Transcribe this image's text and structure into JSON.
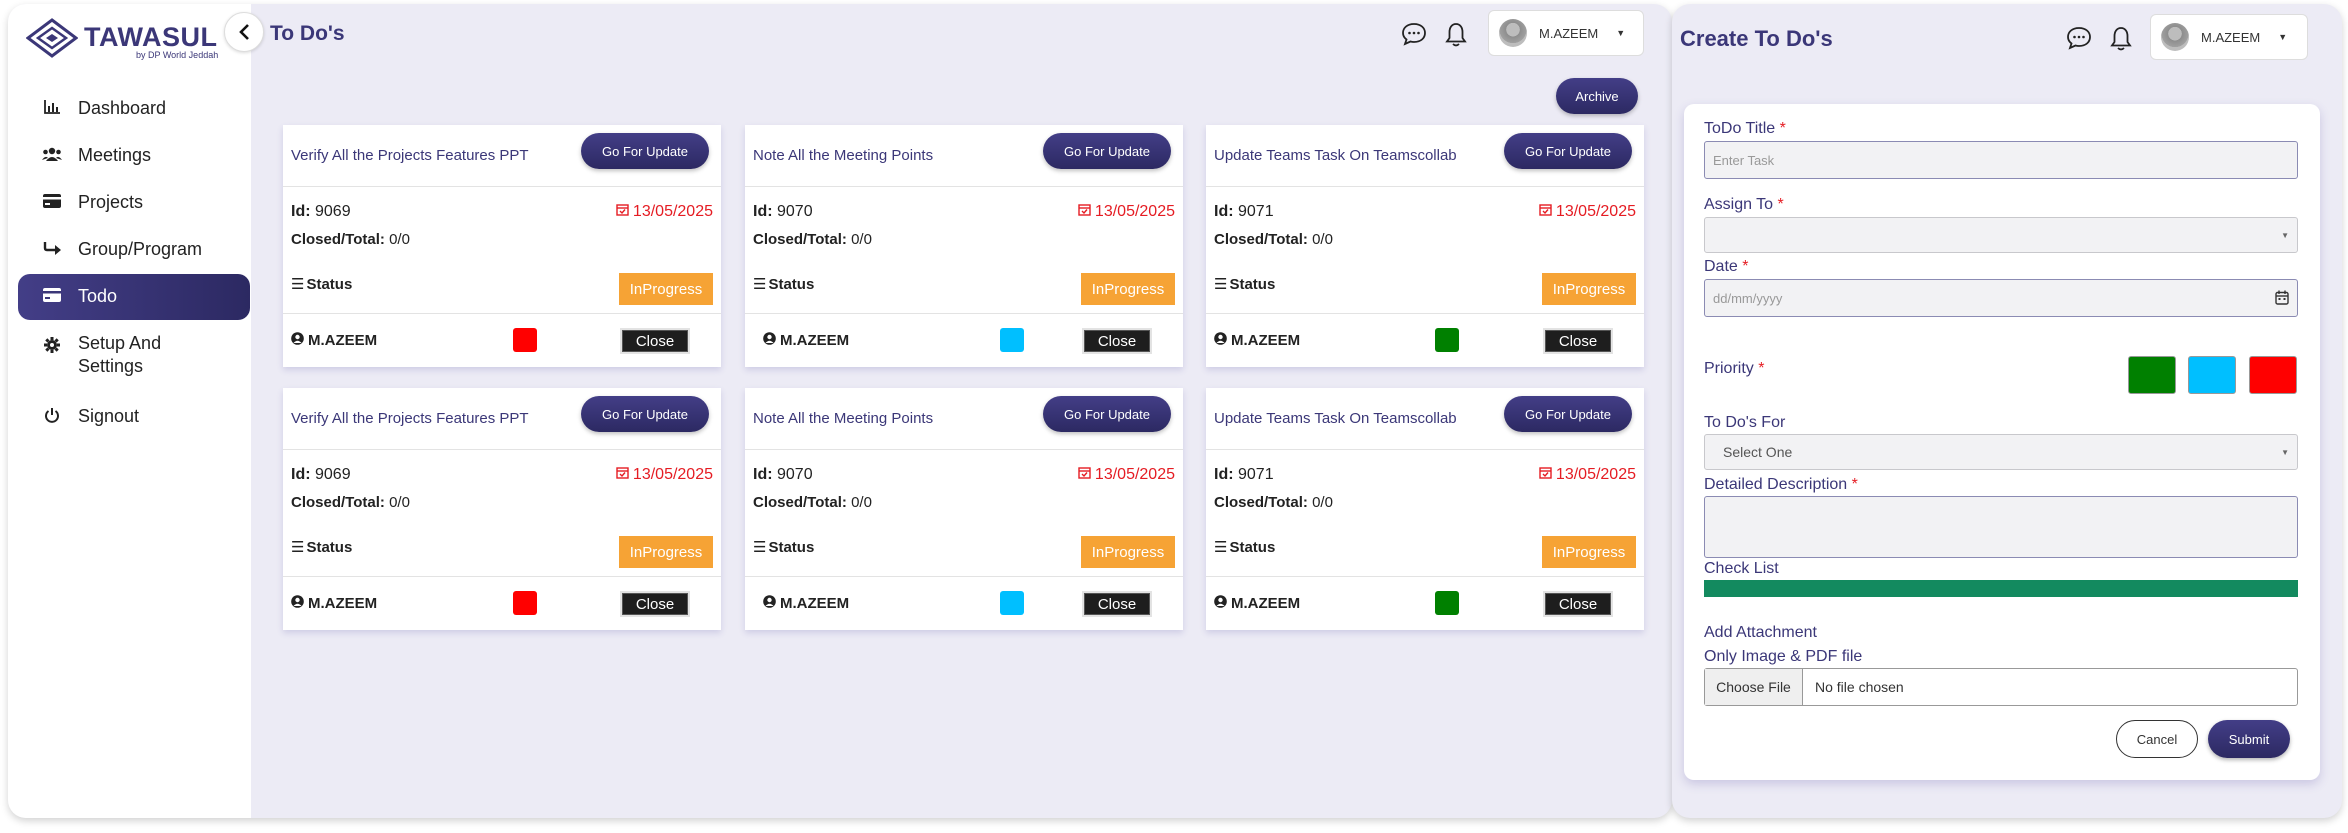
{
  "brand": {
    "name": "TAWASUL",
    "sub": "by DP World Jeddah"
  },
  "sidebar": {
    "items": [
      {
        "label": "Dashboard",
        "icon": "chart-icon"
      },
      {
        "label": "Meetings",
        "icon": "users-icon"
      },
      {
        "label": "Projects",
        "icon": "card-icon"
      },
      {
        "label": "Group/Program",
        "icon": "arrow-icon"
      },
      {
        "label": "Todo",
        "icon": "card-icon",
        "active": true
      },
      {
        "label": "Setup And Settings",
        "icon": "gear-icon"
      },
      {
        "label": "Signout",
        "icon": "power-icon"
      }
    ]
  },
  "header": {
    "title": "To Do's",
    "user": "M.AZEEM"
  },
  "toolbar": {
    "archive_label": "Archive"
  },
  "colors": {
    "accent": "#3b3778",
    "red": "#ff0000",
    "blue": "#00bfff",
    "green": "#008000",
    "badge": "#f6a335"
  },
  "cards": [
    {
      "title": "Verify All the Projects Features PPT",
      "update_label": "Go For Update",
      "id_label": "Id:",
      "id": "9069",
      "date": "13/05/2025",
      "closed_label": "Closed/Total:",
      "closed": "0/0",
      "status_label": "Status",
      "status": "InProgress",
      "user": "M.AZEEM",
      "priority_color": "#ff0000",
      "close_label": "Close"
    },
    {
      "title": "Note All the Meeting Points",
      "update_label": "Go For Update",
      "id_label": "Id:",
      "id": "9070",
      "date": "13/05/2025",
      "closed_label": "Closed/Total:",
      "closed": "0/0",
      "status_label": "Status",
      "status": "InProgress",
      "user": "M.AZEEM",
      "priority_color": "#00bfff",
      "close_label": "Close"
    },
    {
      "title": "Update Teams Task On Teamscollab",
      "update_label": "Go For Update",
      "id_label": "Id:",
      "id": "9071",
      "date": "13/05/2025",
      "closed_label": "Closed/Total:",
      "closed": "0/0",
      "status_label": "Status",
      "status": "InProgress",
      "user": "M.AZEEM",
      "priority_color": "#008000",
      "close_label": "Close"
    },
    {
      "title": "Verify All the Projects Features PPT",
      "update_label": "Go For Update",
      "id_label": "Id:",
      "id": "9069",
      "date": "13/05/2025",
      "closed_label": "Closed/Total:",
      "closed": "0/0",
      "status_label": "Status",
      "status": "InProgress",
      "user": "M.AZEEM",
      "priority_color": "#ff0000",
      "close_label": "Close"
    },
    {
      "title": "Note All the Meeting Points",
      "update_label": "Go For Update",
      "id_label": "Id:",
      "id": "9070",
      "date": "13/05/2025",
      "closed_label": "Closed/Total:",
      "closed": "0/0",
      "status_label": "Status",
      "status": "InProgress",
      "user": "M.AZEEM",
      "priority_color": "#00bfff",
      "close_label": "Close"
    },
    {
      "title": "Update Teams Task On Teamscollab",
      "update_label": "Go For Update",
      "id_label": "Id:",
      "id": "9071",
      "date": "13/05/2025",
      "closed_label": "Closed/Total:",
      "closed": "0/0",
      "status_label": "Status",
      "status": "InProgress",
      "user": "M.AZEEM",
      "priority_color": "#008000",
      "close_label": "Close"
    }
  ],
  "form": {
    "title": "Create To Do's",
    "user": "M.AZEEM",
    "todo_title_label": "ToDo Title",
    "todo_title_placeholder": "Enter Task",
    "assign_label": "Assign To",
    "date_label": "Date",
    "date_placeholder": "dd/mm/yyyy",
    "priority_label": "Priority",
    "todos_for_label": "To Do's For",
    "todos_for_value": "Select One",
    "description_label": "Detailed Description",
    "checklist_label": "Check List",
    "attachment_label": "Add Attachment",
    "attachment_hint": "Only Image & PDF file",
    "choose_file_label": "Choose File",
    "no_file_label": "No file chosen",
    "cancel_label": "Cancel",
    "submit_label": "Submit",
    "required_mark": "*"
  }
}
